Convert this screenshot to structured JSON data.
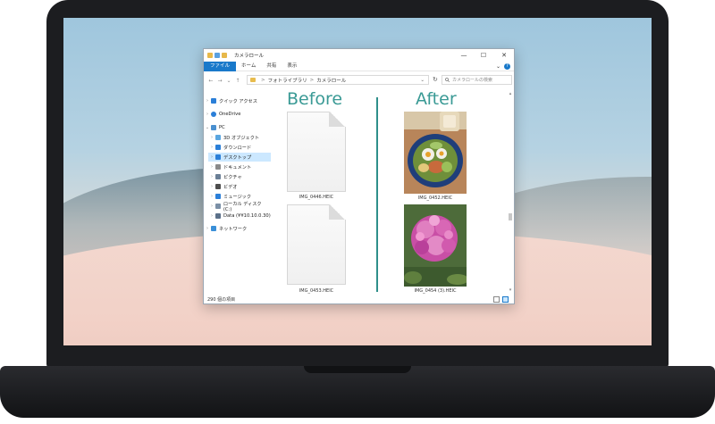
{
  "window": {
    "title": "カメラロール",
    "min": "—",
    "max": "☐",
    "close": "✕"
  },
  "ribbon": {
    "tabs": [
      "ファイル",
      "ホーム",
      "共有",
      "表示"
    ],
    "expand": "⌄",
    "help": "?"
  },
  "address": {
    "back": "←",
    "forward": "→",
    "recent": "⌄",
    "up": "↑",
    "path": [
      "フォトライブラリ",
      "カメラロール"
    ],
    "chevron": ">",
    "dropdown": "⌄",
    "refresh": "↻",
    "search_placeholder": "カメラロールの検索"
  },
  "sidebar": {
    "items": [
      {
        "label": "クイック アクセス",
        "icon": "star-icon",
        "color": "#2b7fd8"
      },
      {
        "label": "OneDrive",
        "icon": "cloud-icon",
        "color": "#2b7fd8"
      },
      {
        "label": "PC",
        "icon": "computer-icon",
        "color": "#4a90d0"
      },
      {
        "label": "3D オブジェクト",
        "icon": "cube-icon",
        "color": "#5aa6e0"
      },
      {
        "label": "ダウンロード",
        "icon": "download-icon",
        "color": "#2b7fd8"
      },
      {
        "label": "デスクトップ",
        "icon": "desktop-icon",
        "color": "#2b7fd8"
      },
      {
        "label": "ドキュメント",
        "icon": "document-icon",
        "color": "#8a8a8a"
      },
      {
        "label": "ピクチャ",
        "icon": "pictures-icon",
        "color": "#6a7f96"
      },
      {
        "label": "ビデオ",
        "icon": "video-icon",
        "color": "#4d4d4d"
      },
      {
        "label": "ミュージック",
        "icon": "music-icon",
        "color": "#2b7fd8"
      },
      {
        "label": "ローカル ディスク (C:)",
        "icon": "disk-icon",
        "color": "#7a8fa6"
      },
      {
        "label": "Data (¥¥10.10.0.30)",
        "icon": "network-drive-icon",
        "color": "#5b7089"
      },
      {
        "label": "ネットワーク",
        "icon": "network-icon",
        "color": "#3a8fd8"
      }
    ]
  },
  "content": {
    "before_heading": "Before",
    "after_heading": "After",
    "before_files": [
      "IMG_0446.HEIC",
      "IMG_0453.HEIC"
    ],
    "after_files": [
      "IMG_0452.HEIC",
      "IMG_0454 (3).HEIC"
    ]
  },
  "status": {
    "count": "290 個の項目"
  },
  "scrollbar": {
    "up": "▴",
    "down": "▾"
  },
  "colors": {
    "accent": "#1979ca",
    "heading": "#3a9a95",
    "divider": "#2f8f8a",
    "selection": "#cce8ff"
  }
}
